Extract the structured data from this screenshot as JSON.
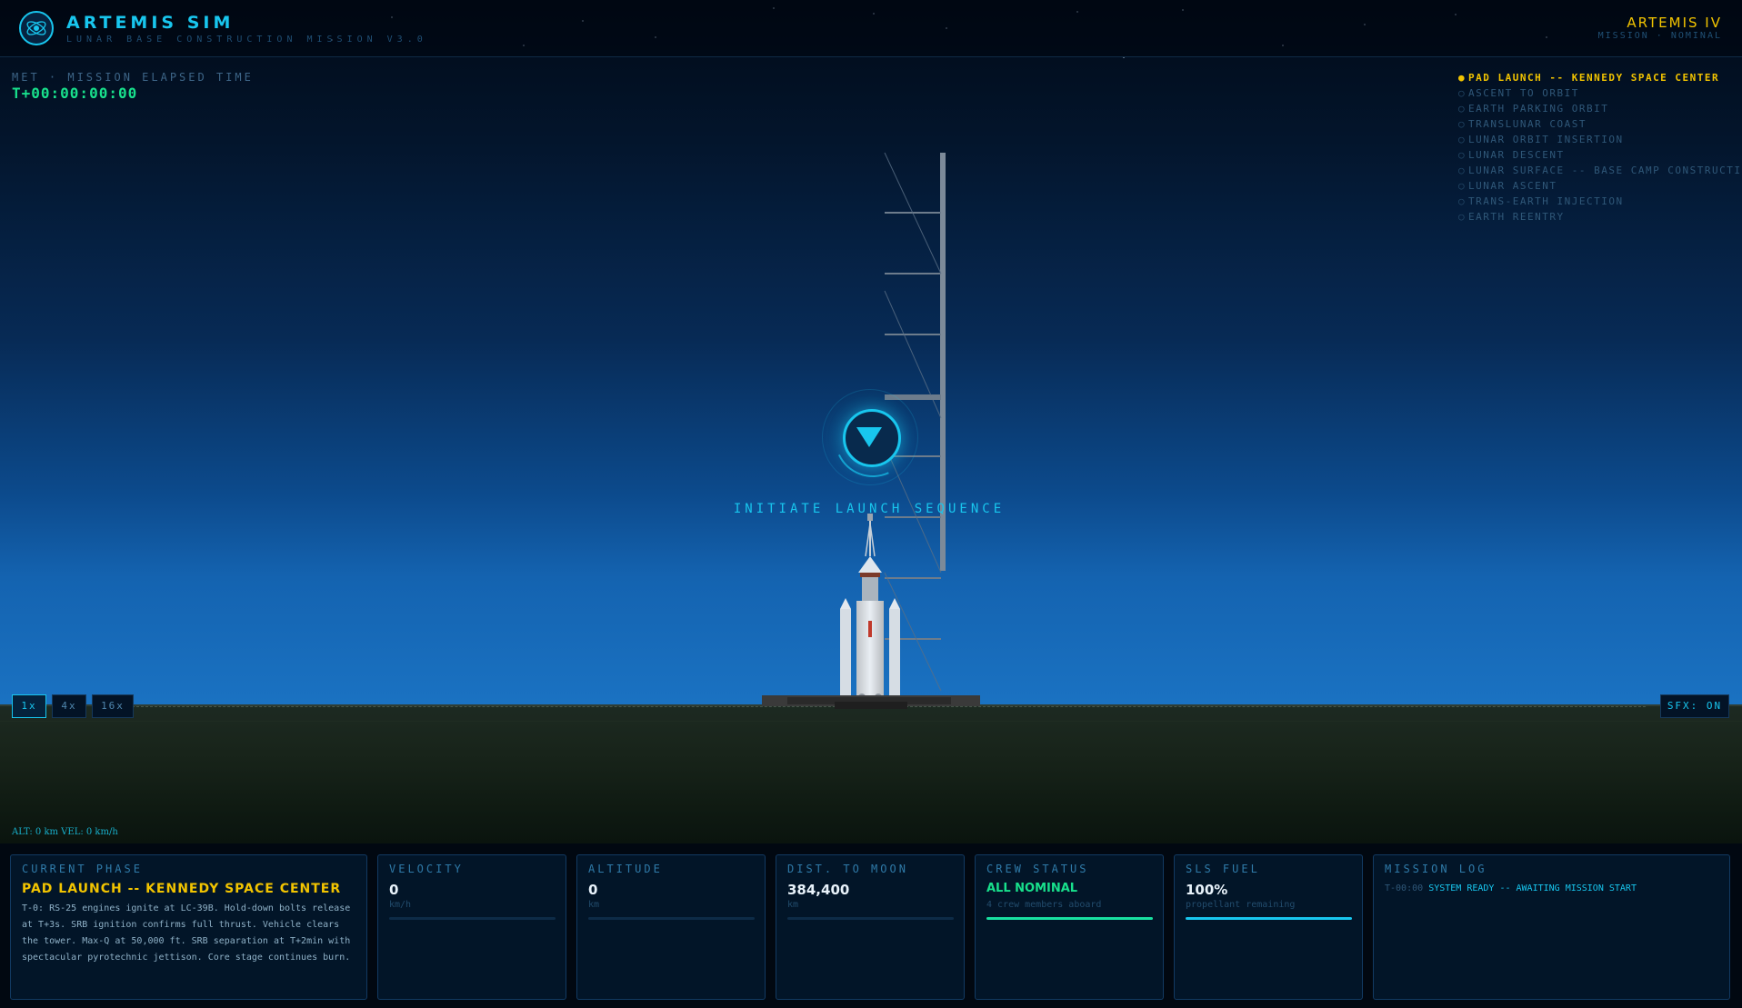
{
  "header": {
    "title": "ARTEMIS SIM",
    "subtitle": "LUNAR BASE CONSTRUCTION MISSION V3.0",
    "mission_name": "ARTEMIS IV",
    "mission_status": "MISSION · NOMINAL"
  },
  "met": {
    "label": "MET · MISSION ELAPSED TIME",
    "value": "T+00:00:00:00"
  },
  "phases": [
    {
      "label": "PAD LAUNCH -- KENNEDY SPACE CENTER",
      "active": true
    },
    {
      "label": "ASCENT TO ORBIT",
      "active": false
    },
    {
      "label": "EARTH PARKING ORBIT",
      "active": false
    },
    {
      "label": "TRANSLUNAR COAST",
      "active": false
    },
    {
      "label": "LUNAR ORBIT INSERTION",
      "active": false
    },
    {
      "label": "LUNAR DESCENT",
      "active": false
    },
    {
      "label": "LUNAR SURFACE -- BASE CAMP CONSTRUCTION",
      "active": false
    },
    {
      "label": "LUNAR ASCENT",
      "active": false
    },
    {
      "label": "TRANS-EARTH INJECTION",
      "active": false
    },
    {
      "label": "EARTH REENTRY",
      "active": false
    }
  ],
  "launch": {
    "label": "INITIATE LAUNCH SEQUENCE",
    "icon": "play-triangle-icon"
  },
  "speed_controls": [
    "1x",
    "4x",
    "16x"
  ],
  "sfx_label": "SFX: ON",
  "readout": "ALT: 0 km   VEL: 0 km/h",
  "panels": {
    "current_phase": {
      "label": "CURRENT PHASE",
      "title": "PAD LAUNCH -- KENNEDY SPACE CENTER",
      "description": "T-0: RS-25 engines ignite at LC-39B. Hold-down bolts release at T+3s. SRB ignition confirms full thrust. Vehicle clears the tower. Max-Q at 50,000 ft. SRB separation at T+2min with spectacular pyrotechnic jettison. Core stage continues burn."
    },
    "velocity": {
      "label": "VELOCITY",
      "value": "0",
      "unit": "km/h",
      "fill": 0
    },
    "altitude": {
      "label": "ALTITUDE",
      "value": "0",
      "unit": "km",
      "fill": 0
    },
    "distance": {
      "label": "DIST. TO MOON",
      "value": "384,400",
      "unit": "km",
      "fill": 0
    },
    "crew": {
      "label": "CREW STATUS",
      "value": "ALL NOMINAL",
      "unit": "4 crew members aboard",
      "fill": 1
    },
    "fuel": {
      "label": "SLS FUEL",
      "value": "100%",
      "unit": "propellant remaining",
      "fill": 1
    },
    "log": {
      "label": "MISSION LOG",
      "entries": [
        {
          "time": "T-00:00",
          "message": "SYSTEM READY -- AWAITING MISSION START"
        }
      ]
    }
  },
  "colors": {
    "accent": "#18c6ee",
    "warning": "#f2c400",
    "nominal": "#18e08c"
  }
}
